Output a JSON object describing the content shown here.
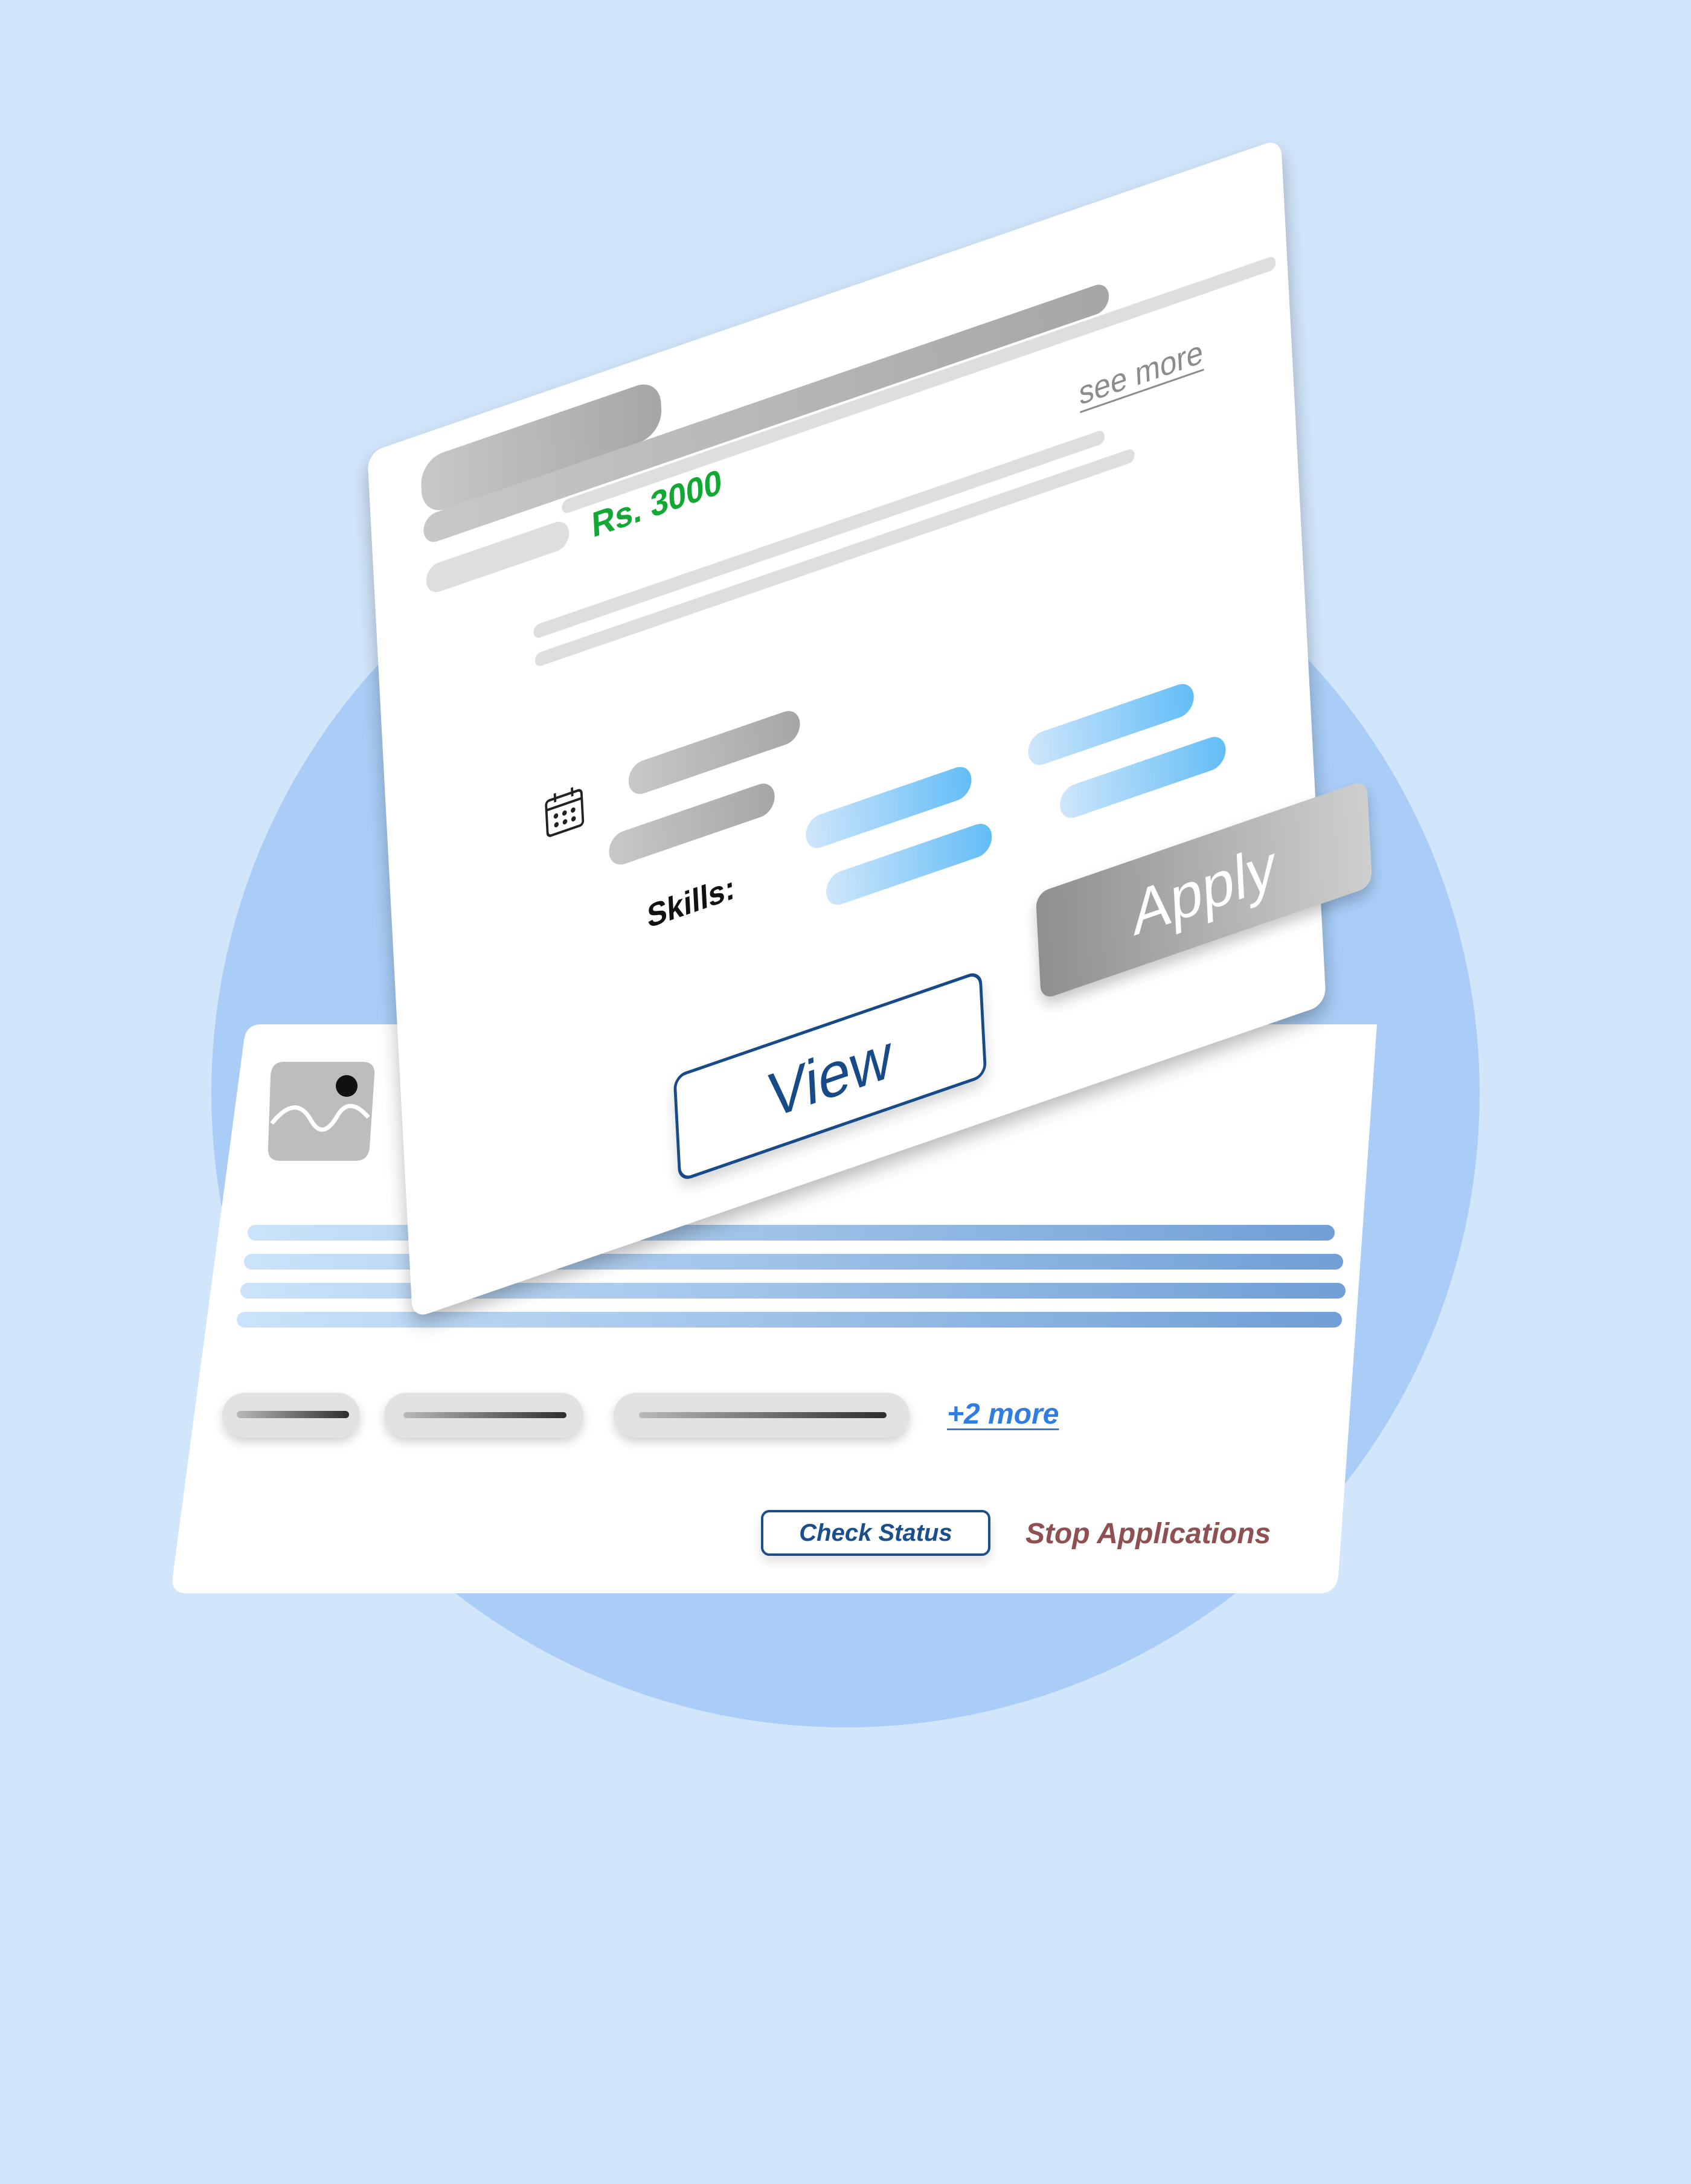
{
  "front_card": {
    "price": "Rs. 3000",
    "see_more": "see more",
    "skills_label": "Skills:",
    "view_button": "View",
    "apply_button": "Apply",
    "icon": "calendar-icon"
  },
  "back_card": {
    "more_link": "+2 more",
    "check_status_button": "Check Status",
    "stop_applications_link": "Stop Applications",
    "icon": "image-placeholder-icon"
  },
  "colors": {
    "background": "#d2e6fb",
    "circle": "#a9cdf7",
    "price": "#13a834",
    "primary_blue": "#174a86",
    "stop_link": "#8e5050",
    "more_link": "#2f7de0"
  }
}
